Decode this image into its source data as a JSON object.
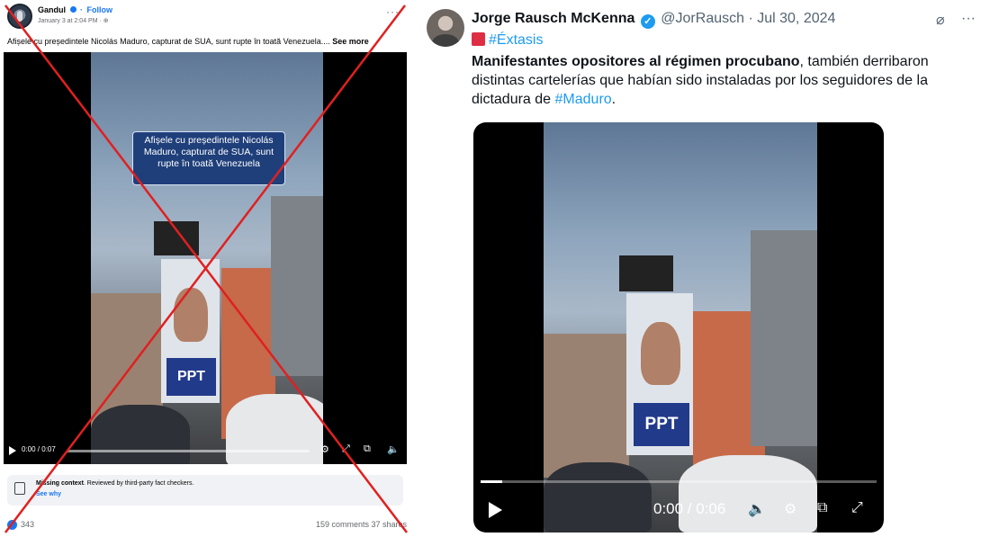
{
  "facebook_post": {
    "author": "Gandul",
    "separator": "·",
    "follow_label": "Follow",
    "date": "January 3 at 2:04 PM · ",
    "caption": "Afișele cu președintele Nicolás Maduro, capturat de SUA, sunt rupte în toată Venezuela....",
    "see_more": "See more",
    "video_overlay_text": "Afișele cu președintele Nicolás Maduro, capturat de SUA, sunt rupte în toată Venezuela",
    "billboard_text": "PPT",
    "video_time": "0:00 / 0:07",
    "fact_check": {
      "bold": "Missing context",
      "text": ". Reviewed by third-party fact checkers.",
      "link": "See why"
    },
    "reactions_count": "343",
    "stats": "159 comments  37 shares",
    "more_menu": "···"
  },
  "tweet": {
    "name": "Jorge Rausch McKenna",
    "verified_icon": "✓",
    "handle_date": " @JorRausch · Jul 30, 2024",
    "grok_icon": "⌀",
    "more_menu": "···",
    "hashtag_topic": "#Éxtasis",
    "text_bold": "Manifestantes opositores al régimen procubano",
    "text_rest": ", también derribaron distintas cartelerías que habían sido instaladas por los seguidores de la dictadura de ",
    "text_hashtag": "#Maduro",
    "text_end": ".",
    "billboard_text": "PPT",
    "video_time": "0:00 / 0:06",
    "controls": {
      "volume": "🔈",
      "settings": "⚙",
      "pip": "⧉",
      "fullscreen": "⤢"
    }
  },
  "colors": {
    "fb_blue": "#1877f2",
    "tw_blue": "#1d9bf0",
    "cross_red": "#e02020"
  }
}
